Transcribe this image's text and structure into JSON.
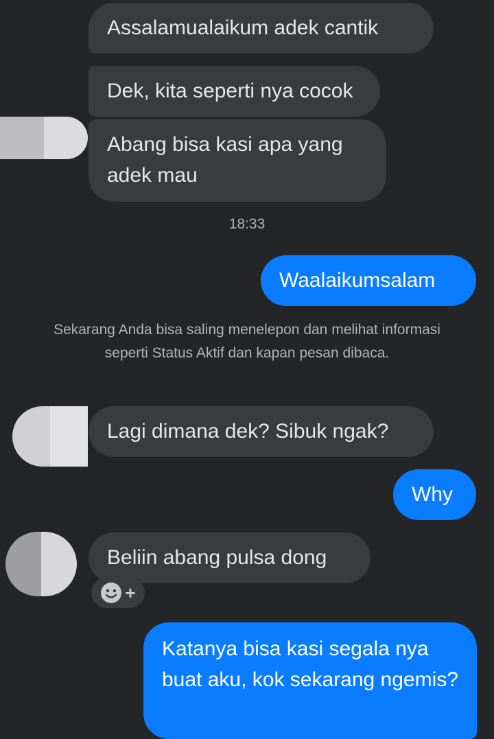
{
  "messages": [
    {
      "id": "m1",
      "direction": "incoming",
      "text": "Assalamualaikum adek cantik"
    },
    {
      "id": "m2",
      "direction": "incoming",
      "text": "Dek, kita seperti nya cocok"
    },
    {
      "id": "m3",
      "direction": "incoming",
      "text": "Abang bisa kasi apa yang adek mau"
    },
    {
      "id": "m4",
      "direction": "outgoing",
      "text": "Waalaikumsalam"
    },
    {
      "id": "m5",
      "direction": "incoming",
      "text": "Lagi dimana dek? Sibuk ngak?"
    },
    {
      "id": "m6",
      "direction": "outgoing",
      "text": "Why"
    },
    {
      "id": "m7",
      "direction": "incoming",
      "text": "Beliin abang pulsa dong"
    },
    {
      "id": "m8",
      "direction": "outgoing",
      "text": "Katanya bisa kasi segala nya buat aku, kok sekarang ngemis?"
    }
  ],
  "timestamp": "18:33",
  "system_notice": "Sekarang Anda bisa saling menelepon dan melihat informasi seperti Status Aktif dan kapan pesan dibaca.",
  "reaction_button": {
    "icon": "smiley-icon",
    "plus": "+"
  },
  "colors": {
    "background": "#242526",
    "incoming_bubble": "#3a3b3c",
    "outgoing_bubble": "#0a7cff",
    "incoming_text": "#e4e6eb",
    "outgoing_text": "#ffffff",
    "meta_text": "#b0b3b8"
  }
}
